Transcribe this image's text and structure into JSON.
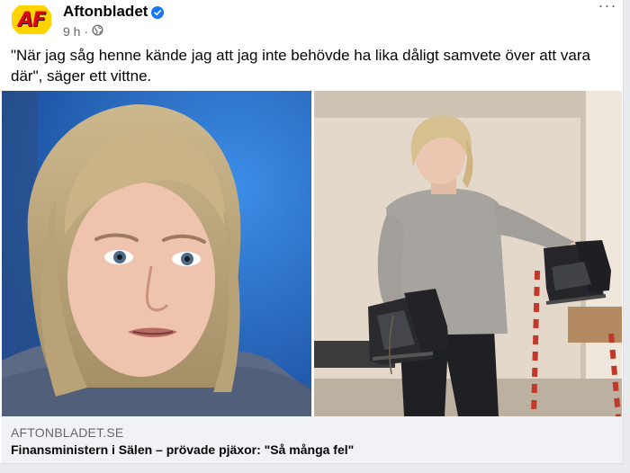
{
  "post": {
    "page_name": "Aftonbladet",
    "logo_text": "AF",
    "time": "9 h",
    "separator": "·",
    "audience_icon": "globe-icon",
    "text": "\"När jag såg henne kände jag att jag inte behövde ha lika dåligt samvete över att vara där\", säger ett vittne.",
    "more_label": "···"
  },
  "link": {
    "domain": "AFTONBLADET.SE",
    "title": "Finansministern i Sälen – prövade pjäxor: \"Så många fel\""
  },
  "colors": {
    "verified": "#1877f2",
    "logo_bg": "#ffd400",
    "logo_text": "#e3001b",
    "footer_bg": "#f0f2f5"
  }
}
